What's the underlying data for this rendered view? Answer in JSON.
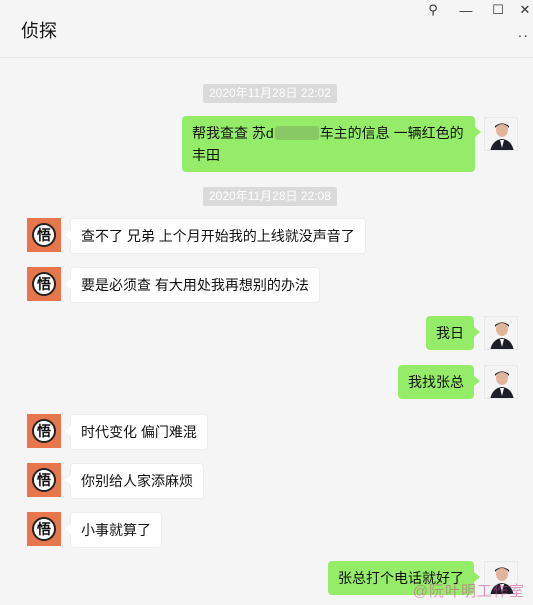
{
  "window": {
    "title": "侦探",
    "controls": {
      "pin": "⚲",
      "minimize": "—",
      "maximize": "☐",
      "close": "✕",
      "more": "··"
    }
  },
  "timestamps": [
    "2020年11月28日 22:02",
    "2020年11月28日 22:08"
  ],
  "avatar_left_glyph": "悟",
  "messages": [
    {
      "side": "me",
      "text_before": "帮我查查 苏d",
      "text_after": "车主的信息   一辆红色的",
      "line2": "丰田"
    },
    {
      "side": "them",
      "text": "查不了 兄弟 上个月开始我的上线就没声音了"
    },
    {
      "side": "them",
      "text": "要是必须查 有大用处我再想别的办法"
    },
    {
      "side": "me",
      "text": "我日"
    },
    {
      "side": "me",
      "text": "我找张总"
    },
    {
      "side": "them",
      "text": "时代变化 偏门难混"
    },
    {
      "side": "them",
      "text": "你别给人家添麻烦"
    },
    {
      "side": "them",
      "text": "小事就算了"
    },
    {
      "side": "me",
      "text": "张总打个电话就好了"
    }
  ],
  "watermark": "@阮叶明工作室",
  "colors": {
    "me_bubble": "#95ec69",
    "them_bubble": "#ffffff",
    "avatar_left_bg": "#e8764d",
    "background": "#f5f5f5"
  }
}
